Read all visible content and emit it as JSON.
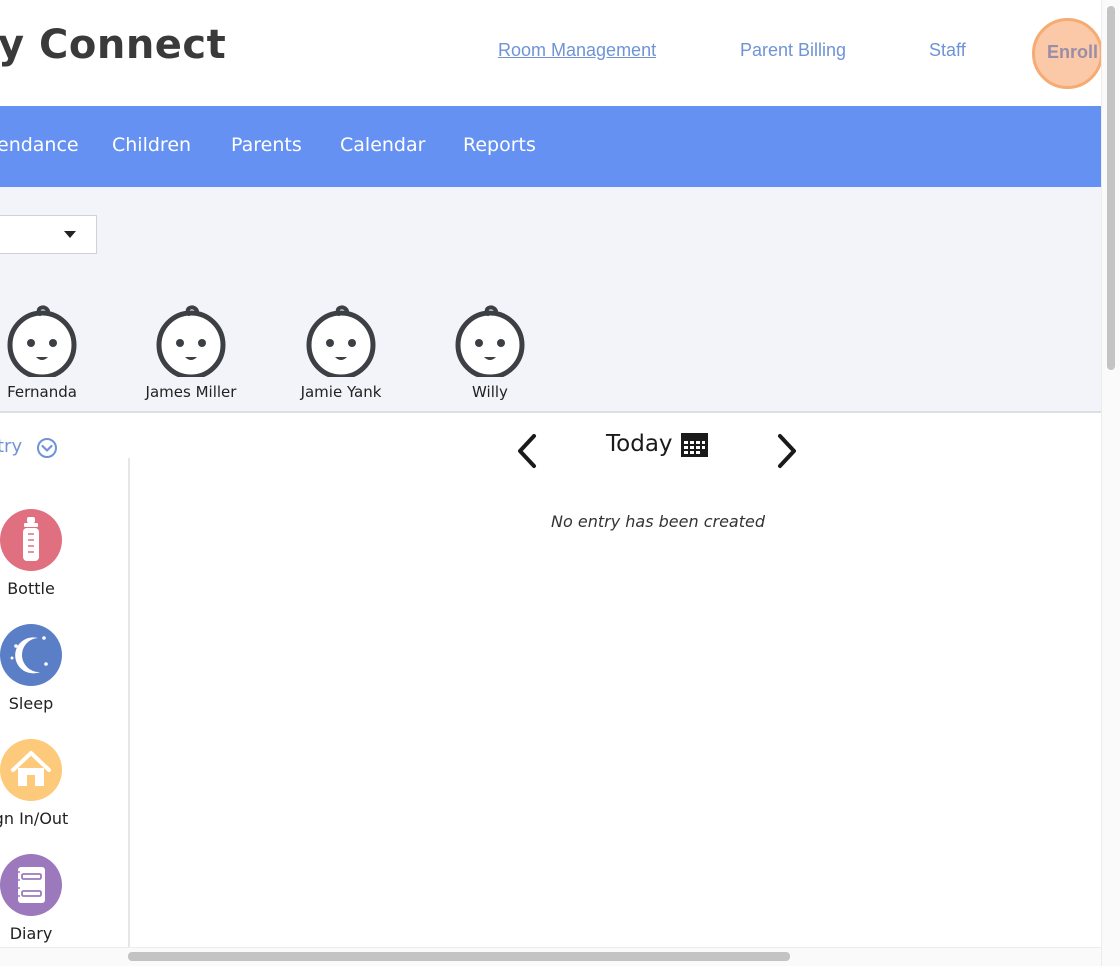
{
  "header": {
    "brand": "y Connect",
    "links": {
      "room_management": "Room Management",
      "parent_billing": "Parent Billing",
      "staff": "Staff",
      "enroll": "Enroll"
    }
  },
  "nav": {
    "items": [
      "endance",
      "Children",
      "Parents",
      "Calendar",
      "Reports"
    ]
  },
  "children": [
    {
      "name": "Fernanda",
      "icon": "baby-face-icon"
    },
    {
      "name": "James Miller",
      "icon": "baby-face-icon"
    },
    {
      "name": "Jamie Yank",
      "icon": "baby-face-icon"
    },
    {
      "name": "Willy",
      "icon": "baby-face-icon"
    }
  ],
  "entry_panel": {
    "title": "try",
    "actions": [
      {
        "label": "Bottle",
        "icon": "baby-bottle-icon",
        "color": "#e0707f"
      },
      {
        "label": "Sleep",
        "icon": "moon-stars-icon",
        "color": "#5b7fc6"
      },
      {
        "label": "gn In/Out",
        "icon": "house-icon",
        "color": "#fdc97a"
      },
      {
        "label": "Diary",
        "icon": "notebook-icon",
        "color": "#9c79bd"
      }
    ]
  },
  "date_nav": {
    "label": "Today",
    "empty_message": "No entry has been created"
  },
  "colors": {
    "nav_bg": "#6591f2",
    "link": "#6f93d6",
    "enroll_bg": "#fbc9a7",
    "enroll_border": "#f6ab73",
    "kids_bg": "#f3f4f9"
  }
}
